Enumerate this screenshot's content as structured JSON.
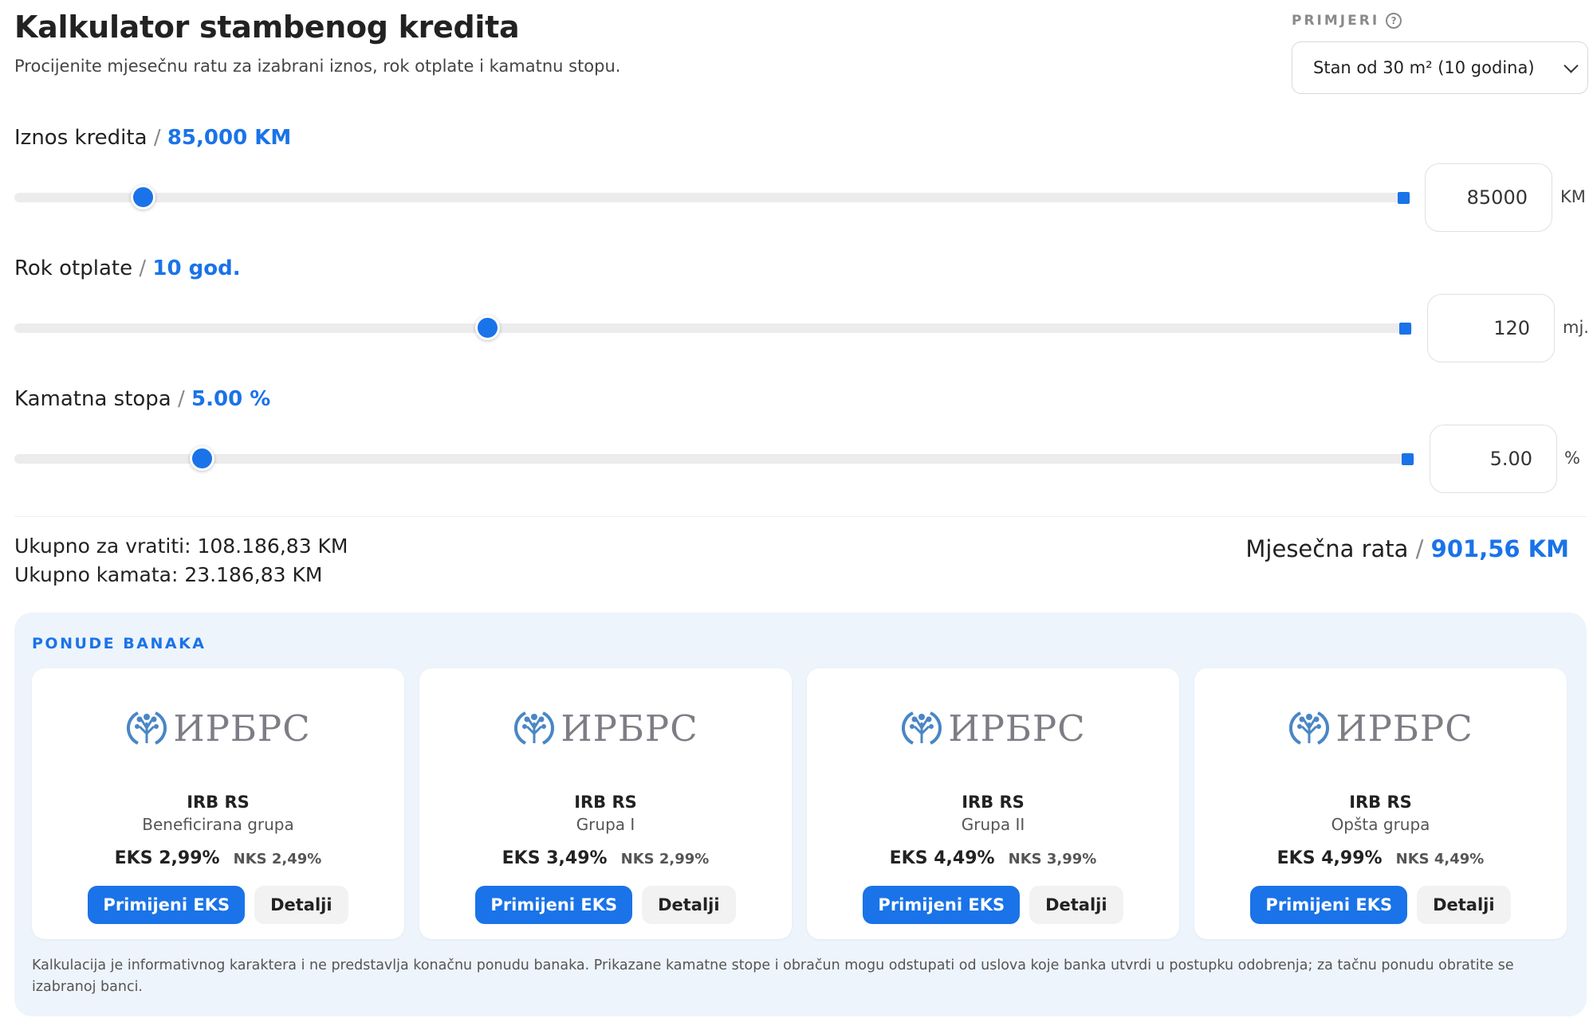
{
  "header": {
    "title": "Kalkulator stambenog kredita",
    "subtitle": "Procijenite mjesečnu ratu za izabrani iznos, rok otplate i kamatnu stopu."
  },
  "examples": {
    "label": "PRIMJERI",
    "help_icon": "?",
    "selected": "Stan od 30 m² (10 godina)"
  },
  "fields": {
    "amount": {
      "label": "Iznos kredita",
      "sep": "/",
      "display": "85,000 KM",
      "input_value": "85000",
      "unit": "KM",
      "slider_level": 0.092
    },
    "term": {
      "label": "Rok otplate",
      "sep": "/",
      "display": "10 god.",
      "input_value": "120",
      "unit": "mj.",
      "slider_level": 0.338
    },
    "rate": {
      "label": "Kamatna stopa",
      "sep": "/",
      "display": "5.00 %",
      "input_value": "5.00",
      "unit": "%",
      "slider_level": 0.134
    }
  },
  "summary": {
    "total_repay": "Ukupno za vratiti: 108.186,83 KM",
    "total_interest": "Ukupno kamata: 23.186,83 KM",
    "monthly_label": "Mjesečna rata",
    "monthly_sep": "/",
    "monthly_value": "901,56 KM"
  },
  "offers": {
    "title": "PONUDE BANAKA",
    "cards": [
      {
        "logo_text": "ИРБРС",
        "bank": "IRB RS",
        "group": "Beneficirana grupa",
        "eks": "EKS 2,99%",
        "nks": "NKS 2,49%",
        "apply": "Primijeni EKS",
        "details": "Detalji"
      },
      {
        "logo_text": "ИРБРС",
        "bank": "IRB RS",
        "group": "Grupa I",
        "eks": "EKS 3,49%",
        "nks": "NKS 2,99%",
        "apply": "Primijeni EKS",
        "details": "Detalji"
      },
      {
        "logo_text": "ИРБРС",
        "bank": "IRB RS",
        "group": "Grupa II",
        "eks": "EKS 4,49%",
        "nks": "NKS 3,99%",
        "apply": "Primijeni EKS",
        "details": "Detalji"
      },
      {
        "logo_text": "ИРБРС",
        "bank": "IRB RS",
        "group": "Opšta grupa",
        "eks": "EKS 4,99%",
        "nks": "NKS 4,49%",
        "apply": "Primijeni EKS",
        "details": "Detalji"
      }
    ],
    "disclaimer": "Kalkulacija je informativnog karaktera i ne predstavlja konačnu ponudu banaka. Prikazane kamatne stope i obračun mogu odstupati od uslova koje banka utvrdi u postupku odobrenja; za tačnu ponudu obratite se izabranoj banci."
  },
  "colors": {
    "accent": "#1a73e8",
    "panel": "#eef4fb",
    "track": "#ececec"
  },
  "icons": {
    "help": "help-circle-icon",
    "dropdown": "chevron-down-icon",
    "logo": "tree-logo-icon"
  }
}
